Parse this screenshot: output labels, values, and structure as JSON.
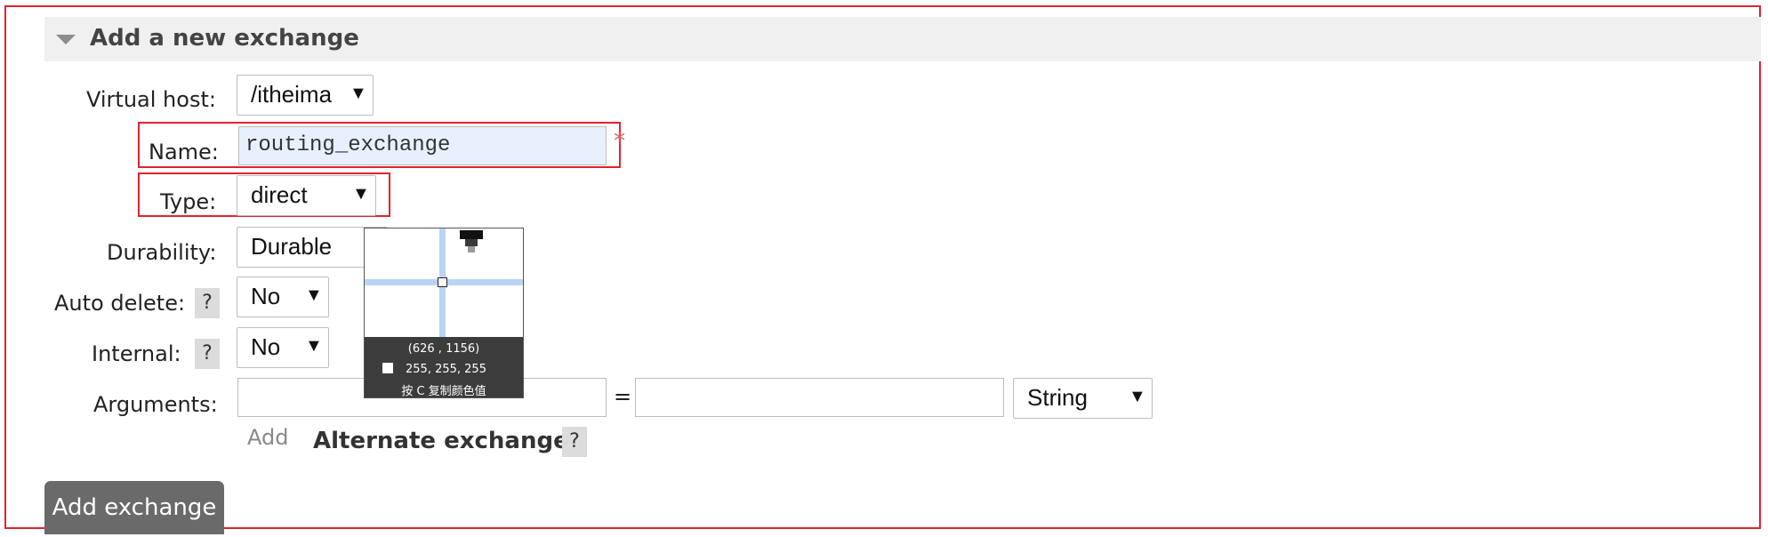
{
  "section": {
    "title": "Add a new exchange"
  },
  "form": {
    "virtual_host": {
      "label": "Virtual host:",
      "value": "/itheima"
    },
    "name": {
      "label": "Name:",
      "value": "routing_exchange",
      "required_mark": "*"
    },
    "type": {
      "label": "Type:",
      "value": "direct"
    },
    "durability": {
      "label": "Durability:",
      "value": "Durable"
    },
    "auto_delete": {
      "label": "Auto delete:",
      "value": "No",
      "help": "?"
    },
    "internal": {
      "label": "Internal:",
      "value": "No",
      "help": "?"
    },
    "arguments": {
      "label": "Arguments:",
      "key": "",
      "value": "",
      "equals": "=",
      "type_value": "String",
      "add_link": "Add"
    },
    "alternate_exchange": {
      "label": "Alternate exchange",
      "help": "?"
    },
    "submit_label": "Add exchange"
  },
  "color_picker": {
    "coords": "(626 , 1156)",
    "rgb": "255, 255, 255",
    "hint": "按 C 复制颜色值"
  },
  "icons": {
    "collapse": "triangle-down-icon",
    "dropdown": "caret-down-icon",
    "help": "question-mark-icon"
  },
  "colors": {
    "highlight_border": "#e0232f",
    "header_bg": "#f0f0f0",
    "button_bg": "#6a6a6a",
    "name_input_bg": "#e8f0fe"
  }
}
